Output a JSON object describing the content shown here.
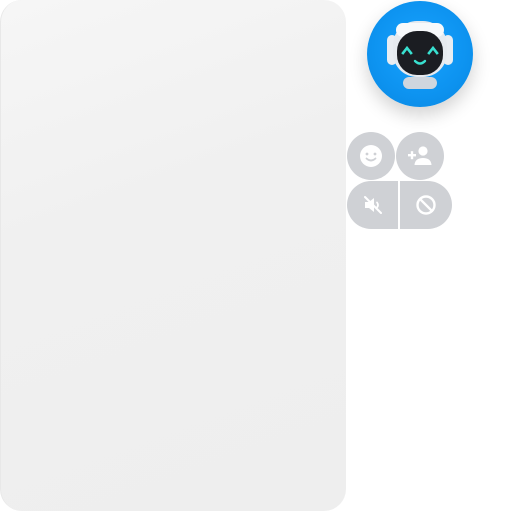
{
  "colors": {
    "avatar_bg": "#0d93f0",
    "button_bg": "#cfd1d5",
    "icon_fg": "#ffffff",
    "panel_bg": "#f0f0f0",
    "robot_eye": "#38e0d0"
  },
  "avatar": {
    "icon": "robot-face-icon"
  },
  "actions": [
    {
      "name": "emoji",
      "icon": "smiley-icon"
    },
    {
      "name": "add-contact",
      "icon": "add-person-icon"
    },
    {
      "name": "mute",
      "icon": "speaker-muted-icon"
    },
    {
      "name": "block",
      "icon": "block-icon"
    }
  ]
}
